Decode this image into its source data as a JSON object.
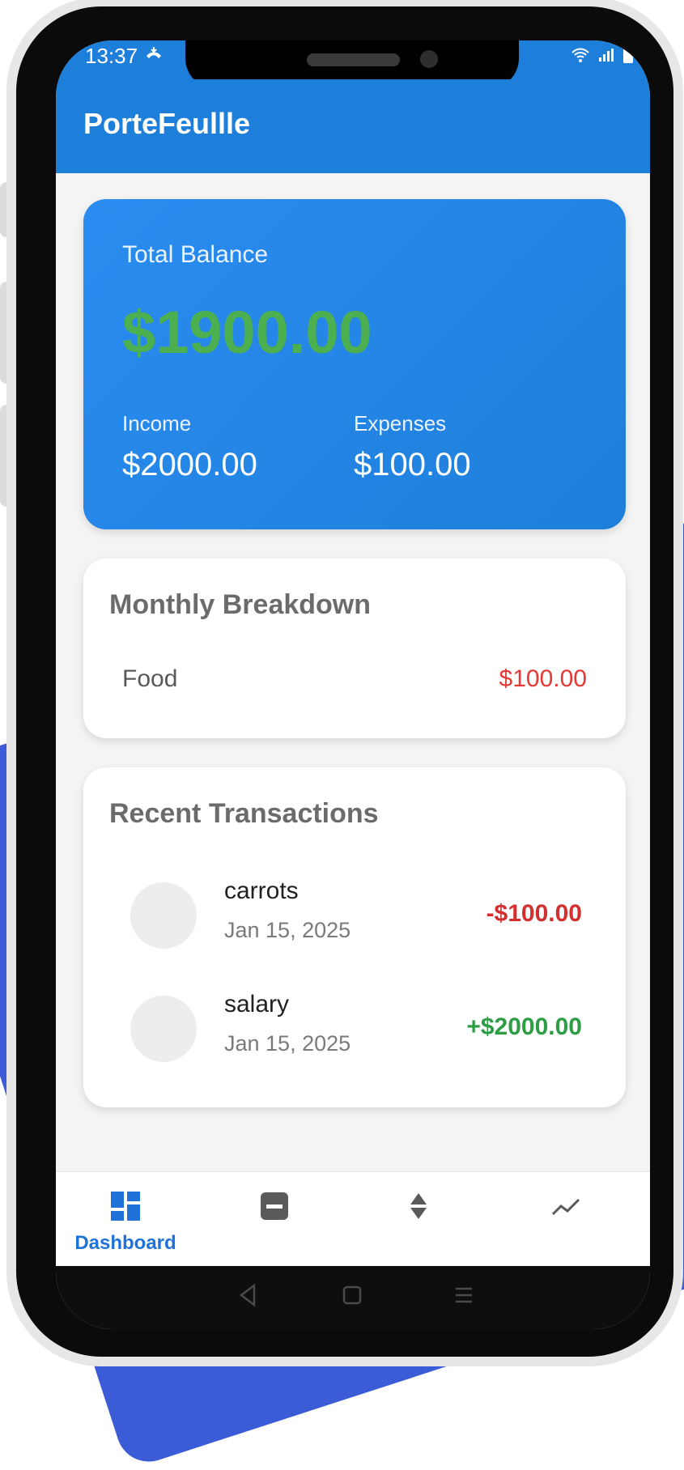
{
  "status_bar": {
    "time": "13:37"
  },
  "app": {
    "title": "PorteFeullle"
  },
  "balance_card": {
    "label": "Total Balance",
    "value": "$1900.00",
    "income_label": "Income",
    "income_value": "$2000.00",
    "expenses_label": "Expenses",
    "expenses_value": "$100.00"
  },
  "monthly_breakdown": {
    "title": "Monthly Breakdown",
    "items": [
      {
        "category": "Food",
        "amount": "$100.00"
      }
    ]
  },
  "recent_transactions": {
    "title": "Recent Transactions",
    "items": [
      {
        "name": "carrots",
        "date": "Jan 15, 2025",
        "amount": "-$100.00",
        "type": "expense"
      },
      {
        "name": "salary",
        "date": "Jan 15, 2025",
        "amount": "+$2000.00",
        "type": "income"
      }
    ]
  },
  "bottom_nav": {
    "items": [
      {
        "label": "Dashboard",
        "icon": "dashboard-icon",
        "active": true
      },
      {
        "label": "",
        "icon": "minus-box-icon",
        "active": false
      },
      {
        "label": "",
        "icon": "sort-arrows-icon",
        "active": false
      },
      {
        "label": "",
        "icon": "trend-chart-icon",
        "active": false
      }
    ]
  },
  "colors": {
    "primary": "#1e7fda",
    "positive": "#2e9e45",
    "negative": "#d32f2f",
    "background": "#f4f4f4"
  }
}
